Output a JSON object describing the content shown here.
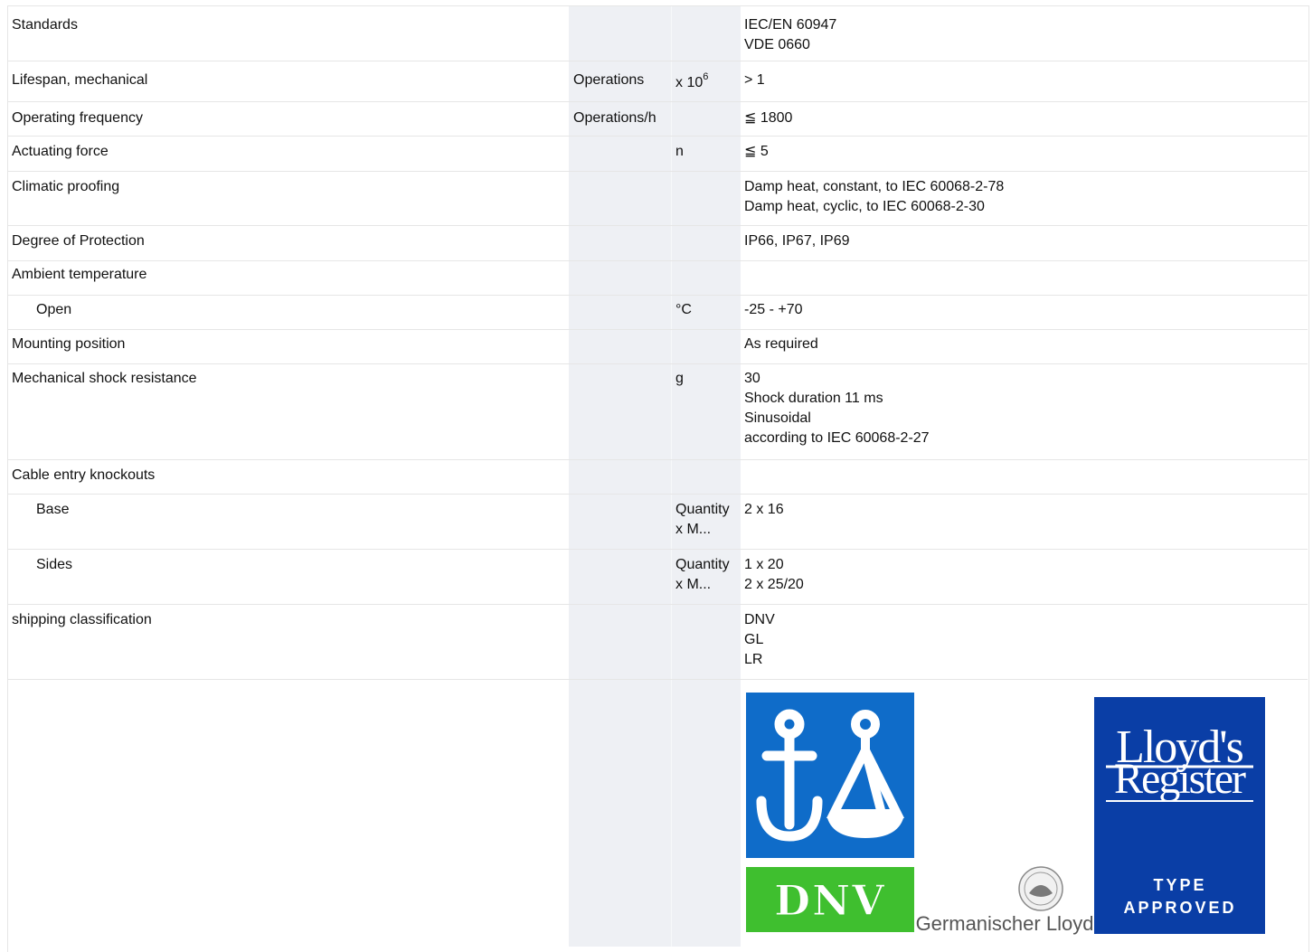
{
  "rows": [
    {
      "label": "Standards",
      "unit": "",
      "unit2": "",
      "values": [
        "IEC/EN 60947",
        "VDE 0660"
      ]
    },
    {
      "label": "Lifespan, mechanical",
      "unit": "Operations",
      "unit2_base": "x 10",
      "unit2_sup": "6",
      "values": [
        "> 1"
      ]
    },
    {
      "label": "Operating frequency",
      "unit": "Operations/h",
      "unit2": "",
      "values": [
        "≦ 1800"
      ]
    },
    {
      "label": "Actuating force",
      "unit": "",
      "unit2": "n",
      "values": [
        "≦ 5"
      ]
    },
    {
      "label": "Climatic proofing",
      "unit": "",
      "unit2": "",
      "values": [
        "Damp heat, constant, to IEC 60068-2-78",
        "Damp heat, cyclic, to IEC 60068-2-30"
      ]
    },
    {
      "label": "Degree of Protection",
      "unit": "",
      "unit2": "",
      "values": [
        "IP66, IP67, IP69"
      ]
    },
    {
      "label": "Ambient temperature",
      "unit": "",
      "unit2": "",
      "values": []
    },
    {
      "label": "Open",
      "unit": "",
      "unit2": "°C",
      "values": [
        "-25 - +70"
      ]
    },
    {
      "label": "Mounting position",
      "unit": "",
      "unit2": "",
      "values": [
        "As required"
      ]
    },
    {
      "label": "Mechanical shock resistance",
      "unit": "",
      "unit2": "g",
      "values": [
        "30",
        "Shock duration 11 ms",
        "Sinusoidal",
        "according to IEC 60068-2-27"
      ]
    },
    {
      "label": "Cable entry knockouts",
      "unit": "",
      "unit2": "",
      "values": []
    },
    {
      "label": "Base",
      "unit": "",
      "unit2_lines": [
        "Quantity",
        "x M..."
      ],
      "values": [
        "2 x 16"
      ]
    },
    {
      "label": "Sides",
      "unit": "",
      "unit2_lines": [
        "Quantity",
        "x M..."
      ],
      "values": [
        "1 x 20",
        "2 x 25/20"
      ]
    },
    {
      "label": "shipping classification",
      "unit": "",
      "unit2": "",
      "values": [
        "DNV",
        "GL",
        "LR"
      ]
    }
  ],
  "logos": {
    "dnv_text": "DNV",
    "gl_text": "Germanischer Lloyd",
    "lr_line1": "Lloyd's",
    "lr_line2": "Register",
    "lr_type": "TYPE",
    "lr_approved": "APPROVED",
    "colors": {
      "dnv_blue": "#0f6cc9",
      "dnv_green": "#3fbf2f",
      "lr_blue": "#0a3ea6",
      "gl_gray": "#555555"
    }
  }
}
